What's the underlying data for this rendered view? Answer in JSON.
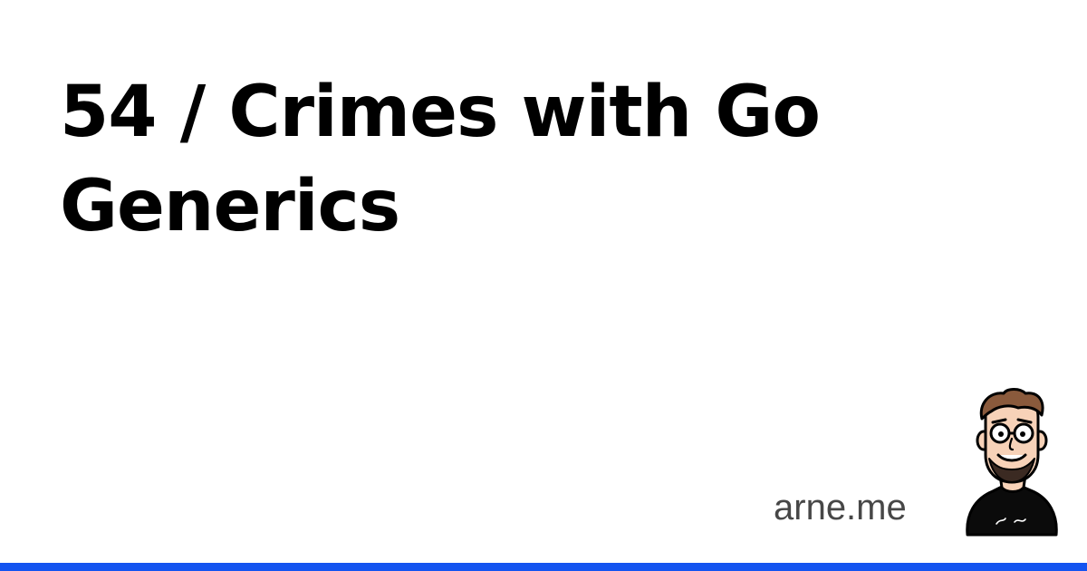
{
  "title": "54 / Crimes with Go Generics",
  "site": "arne.me",
  "avatar_icon": "cartoon-face-avatar-icon",
  "accent_color": "#1454f0"
}
